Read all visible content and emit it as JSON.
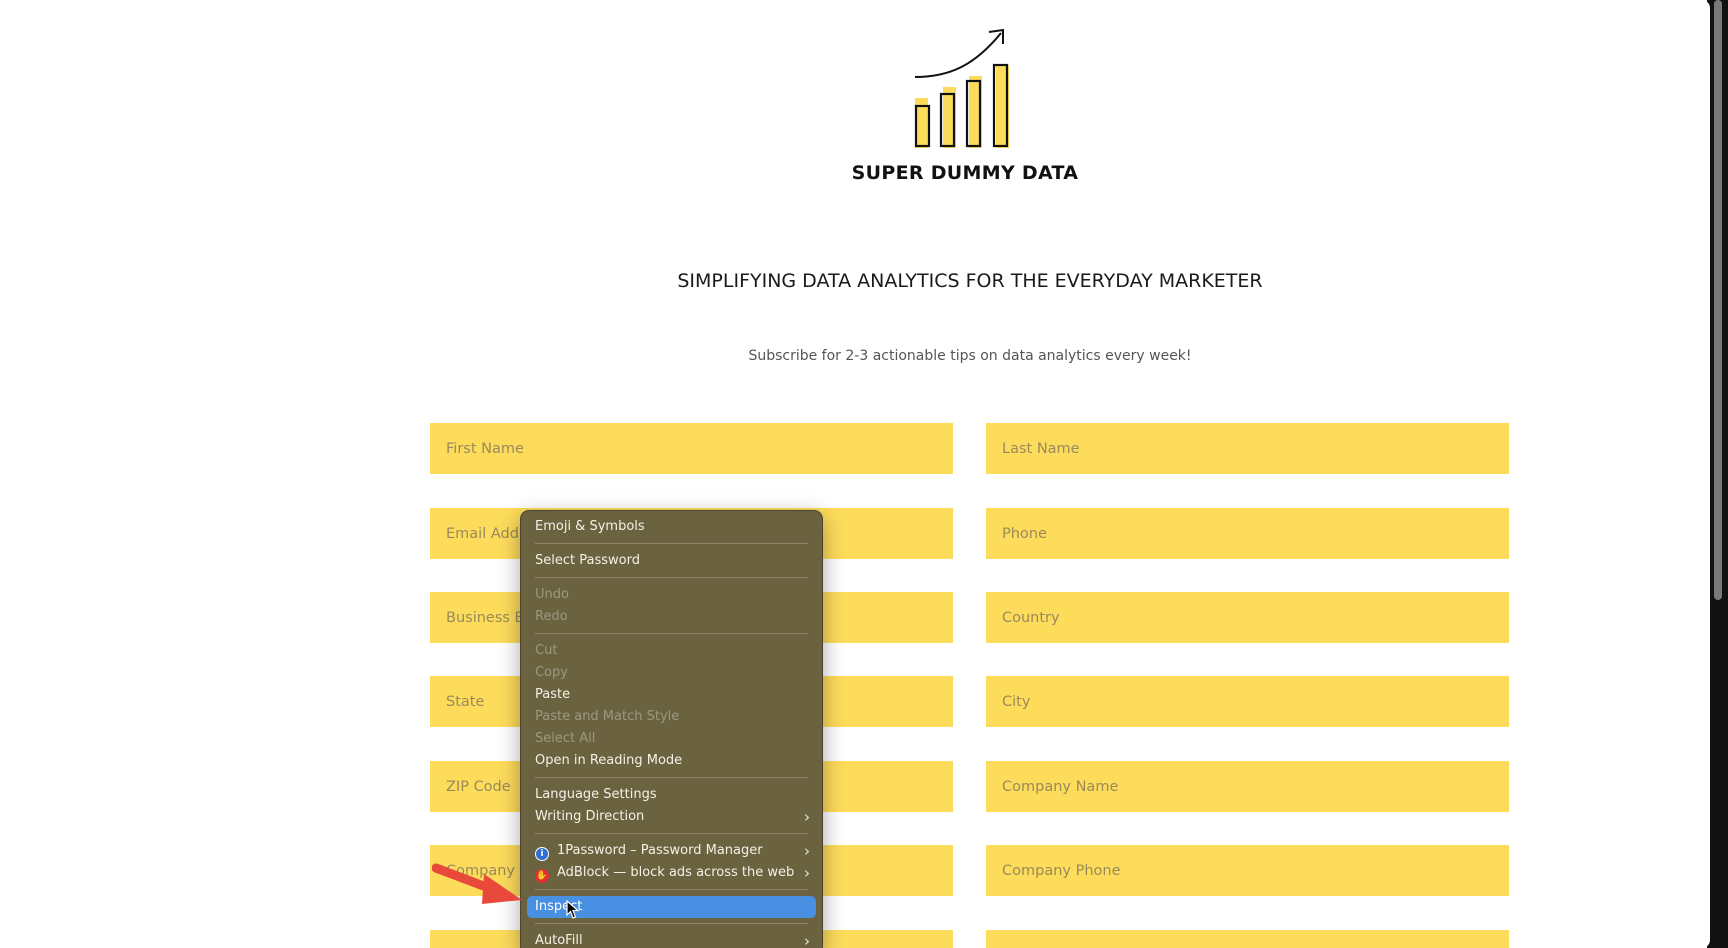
{
  "brand": {
    "name": "SUPER DUMMY DATA",
    "logo_icon": "bar-chart-growth-icon",
    "accent_color": "#fddc5c"
  },
  "hero": {
    "headline": "SIMPLIFYING DATA ANALYTICS FOR THE EVERYDAY MARKETER",
    "subline": "Subscribe for 2-3 actionable tips on data analytics every week!"
  },
  "form": {
    "first_name": "First Name",
    "last_name": "Last Name",
    "email_partial": "Email Addre",
    "phone": "Phone",
    "business_email_partial": "Business Em",
    "country": "Country",
    "state": "State",
    "city": "City",
    "zip": "ZIP Code",
    "company_name": "Company Name",
    "company_website_partial": "Company W",
    "company_phone": "Company Phone"
  },
  "context_menu": {
    "emoji": "Emoji & Symbols",
    "select_password": "Select Password",
    "undo": "Undo",
    "redo": "Redo",
    "cut": "Cut",
    "copy": "Copy",
    "paste": "Paste",
    "paste_match": "Paste and Match Style",
    "select_all": "Select All",
    "reading_mode": "Open in Reading Mode",
    "language_settings": "Language Settings",
    "writing_direction": "Writing Direction",
    "onepassword": "1Password – Password Manager",
    "adblock": "AdBlock — block ads across the web",
    "inspect": "Inspect",
    "autofill": "AutoFill",
    "highlight_color": "#4a90e2"
  }
}
